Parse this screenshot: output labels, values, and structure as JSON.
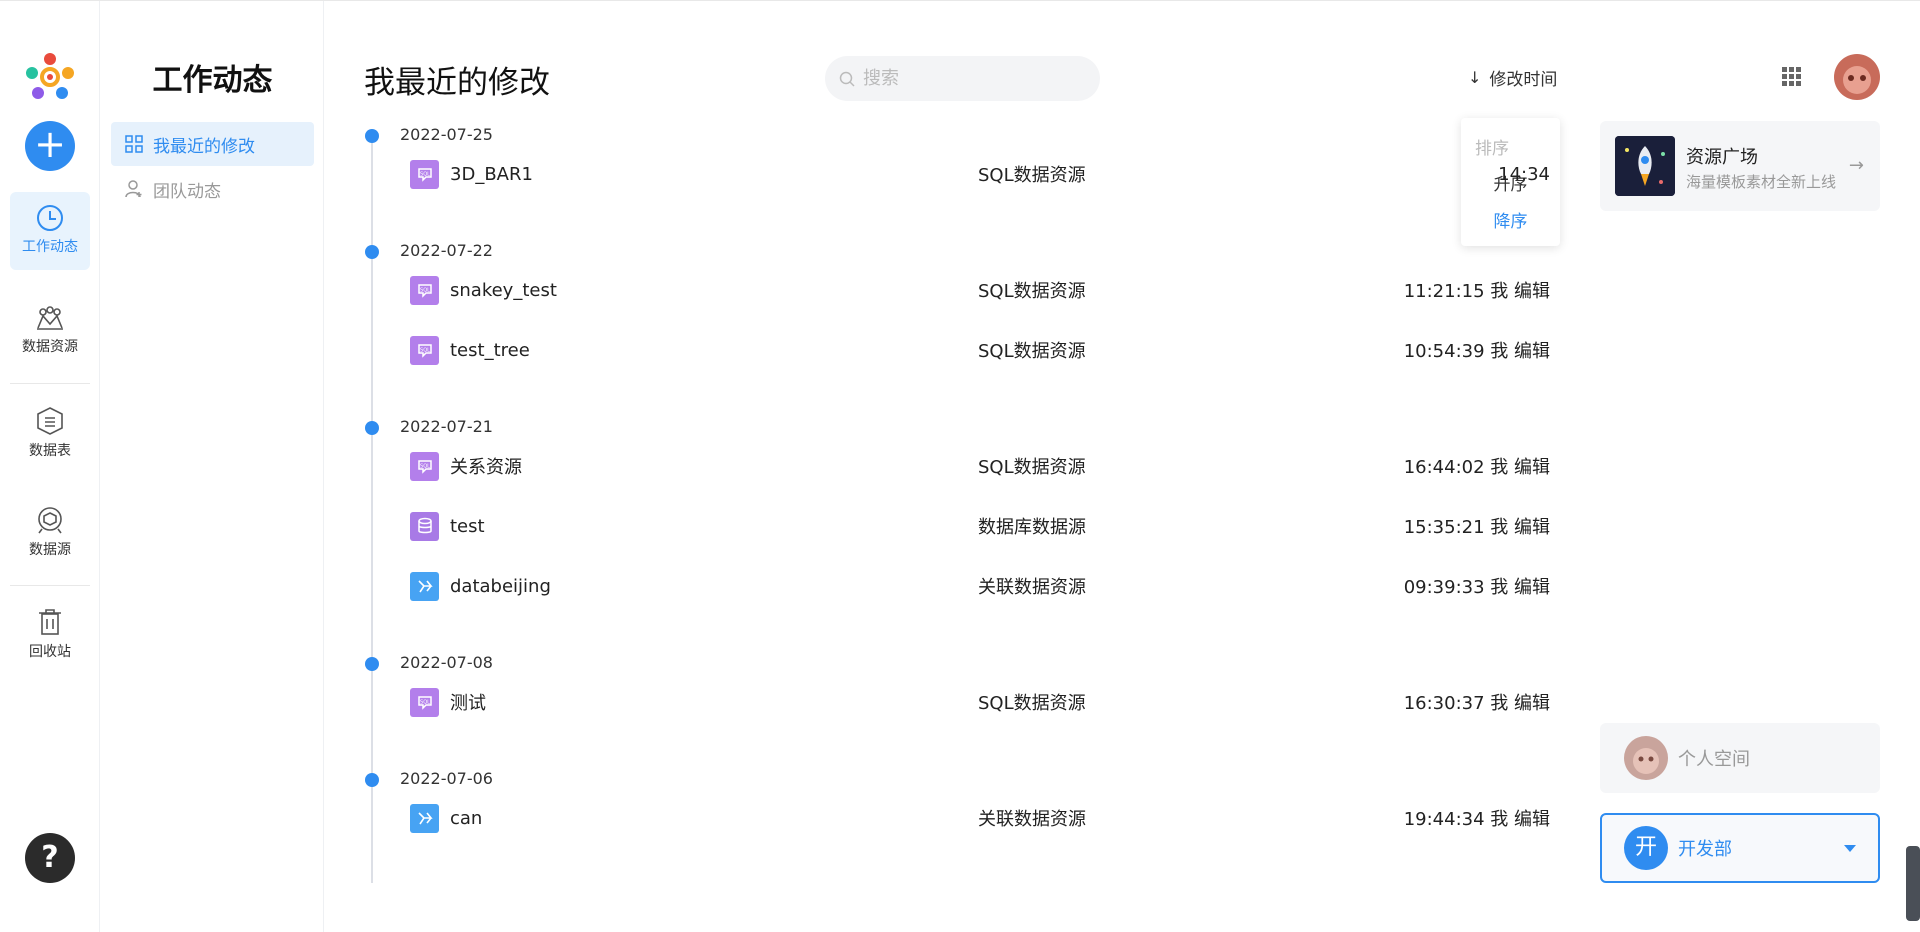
{
  "rail": {
    "items": [
      {
        "label": "工作动态",
        "icon": "clock-icon",
        "active": true
      },
      {
        "label": "数据资源",
        "icon": "data-resource-icon"
      },
      {
        "label": "数据表",
        "icon": "data-table-icon"
      },
      {
        "label": "数据源",
        "icon": "data-source-icon"
      },
      {
        "label": "回收站",
        "icon": "trash-icon"
      }
    ],
    "add_label": "+",
    "help_label": "?"
  },
  "subside": {
    "title": "工作动态",
    "items": [
      {
        "label": "我最近的修改",
        "active": true
      },
      {
        "label": "团队动态",
        "active": false
      }
    ]
  },
  "main": {
    "title": "我最近的修改",
    "search_placeholder": "搜索",
    "sort_label": "修改时间",
    "sort_dropdown": {
      "header": "排序",
      "asc": "升序",
      "desc": "降序",
      "selected": "降序"
    },
    "groups": [
      {
        "date": "2022-07-25",
        "rows": [
          {
            "name": "3D_BAR1",
            "type": "SQL数据资源",
            "time": "14:34",
            "icon": "sql"
          }
        ]
      },
      {
        "date": "2022-07-22",
        "rows": [
          {
            "name": "snakey_test",
            "type": "SQL数据资源",
            "time": "11:21:15 我 编辑",
            "icon": "sql"
          },
          {
            "name": "test_tree",
            "type": "SQL数据资源",
            "time": "10:54:39 我 编辑",
            "icon": "sql"
          }
        ]
      },
      {
        "date": "2022-07-21",
        "rows": [
          {
            "name": "关系资源",
            "type": "SQL数据资源",
            "time": "16:44:02 我 编辑",
            "icon": "sql"
          },
          {
            "name": "test",
            "type": "数据库数据源",
            "time": "15:35:21 我 编辑",
            "icon": "db"
          },
          {
            "name": "databeijing",
            "type": "关联数据资源",
            "time": "09:39:33 我 编辑",
            "icon": "link"
          }
        ]
      },
      {
        "date": "2022-07-08",
        "rows": [
          {
            "name": "测试",
            "type": "SQL数据资源",
            "time": "16:30:37 我 编辑",
            "icon": "sql"
          }
        ]
      },
      {
        "date": "2022-07-06",
        "rows": [
          {
            "name": "can",
            "type": "关联数据资源",
            "time": "19:44:34 我 编辑",
            "icon": "link"
          }
        ]
      }
    ]
  },
  "right": {
    "resource_card": {
      "title": "资源广场",
      "subtitle": "海量模板素材全新上线"
    },
    "personal_space": "个人空间",
    "team": {
      "badge": "开",
      "label": "开发部"
    }
  },
  "colors": {
    "accent": "#2f8cf0",
    "sql_icon": "#b37feb",
    "link_icon": "#47a3f3"
  }
}
